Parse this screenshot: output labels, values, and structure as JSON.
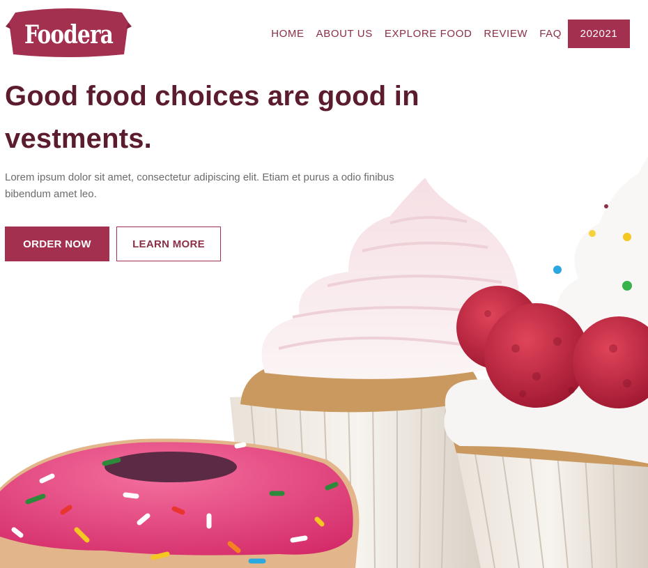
{
  "brand": {
    "name": "Foodera",
    "color": "#a4304f",
    "dark": "#5b1c2e"
  },
  "nav": {
    "items": [
      "HOME",
      "ABOUT US",
      "EXPLORE FOOD",
      "REVIEW",
      "FAQ"
    ],
    "cta_label": "202021"
  },
  "hero": {
    "title": "Good food choices are good in vestments.",
    "description": "Lorem ipsum dolor sit amet, consectetur adipiscing elit. Etiam et purus a odio finibus bibendum amet leo.",
    "order_label": "ORDER NOW",
    "learn_label": "LEARN MORE"
  },
  "illustration": {
    "subjects": [
      "cupcake-with-frosting",
      "cupcake-with-raspberries",
      "sprinkled-donut"
    ]
  }
}
